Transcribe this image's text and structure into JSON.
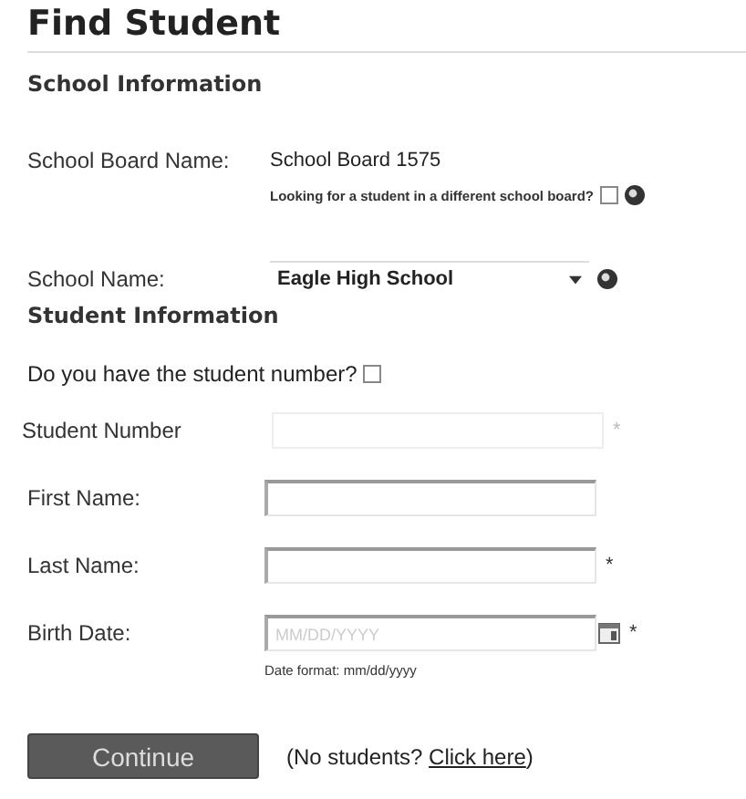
{
  "title": "Find Student",
  "school_section": {
    "heading": "School Information",
    "board": {
      "label": "School Board Name:",
      "value": "School Board 1575",
      "note": "Looking for a student in a different school board?",
      "checked": false
    },
    "school": {
      "label": "School Name:",
      "value": "Eagle High School"
    }
  },
  "student_section": {
    "heading": "Student Information",
    "question": "Do you have the student number?",
    "checked": false,
    "fields": [
      {
        "label": "Student Number",
        "kind": "text",
        "disabled": true,
        "required_mark": "*"
      },
      {
        "label": "First Name:",
        "kind": "text",
        "disabled": false
      },
      {
        "label": "Last Name:",
        "kind": "text",
        "disabled": false,
        "required_mark": "*"
      },
      {
        "label": "Birth Date:",
        "kind": "date",
        "disabled": false,
        "required_mark": "*",
        "placeholder": "MM/DD/YYYY",
        "hint": "Date format: mm/dd/yyyy"
      }
    ]
  },
  "continue_button": "Continue",
  "footer": {
    "prefix": "(No students? ",
    "link": "Click here",
    "suffix": ")"
  }
}
